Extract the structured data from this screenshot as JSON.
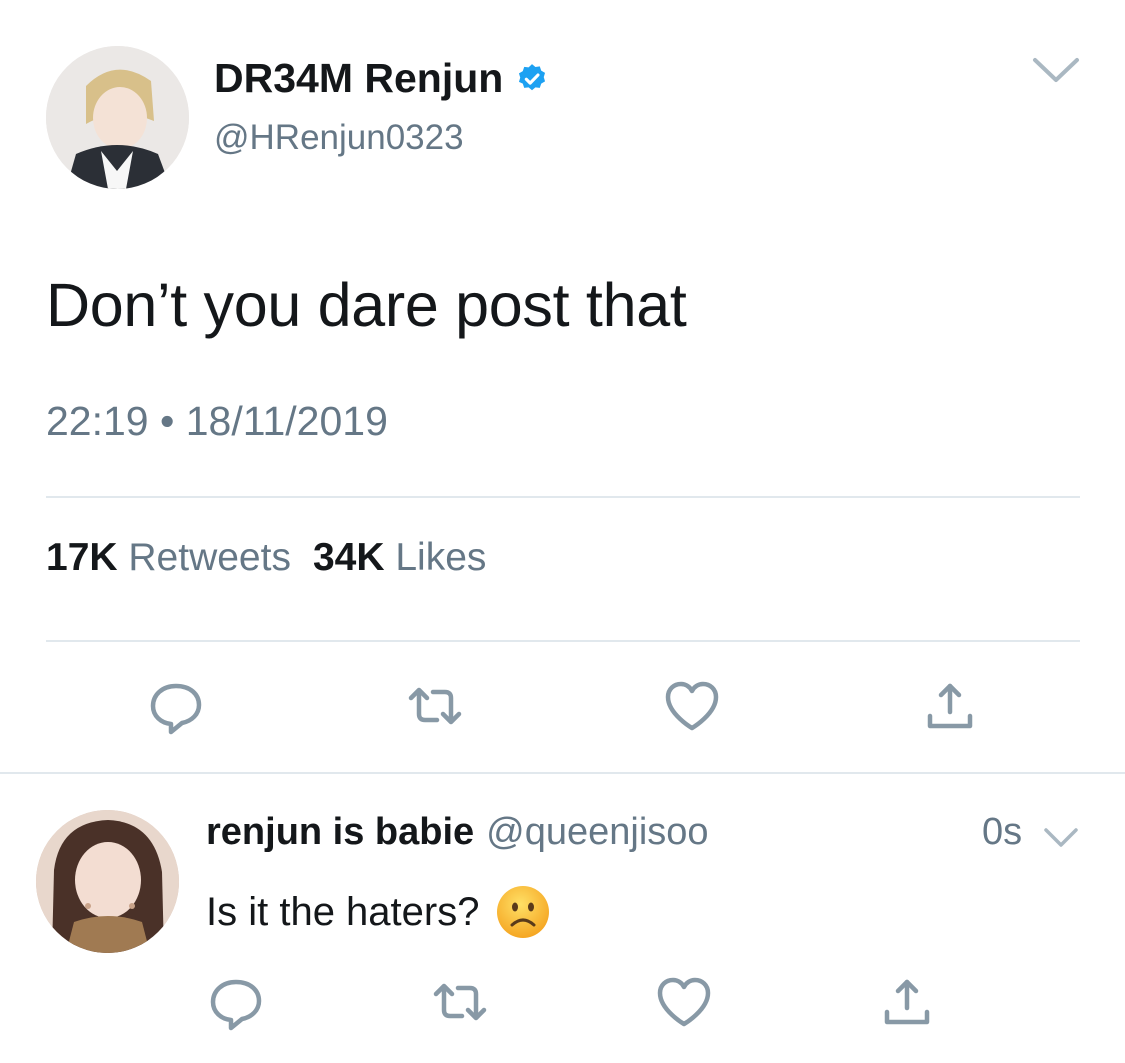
{
  "tweet": {
    "display_name": "DR34M Renjun",
    "handle": "@HRenjun0323",
    "text": "Don’t you dare post that",
    "timestamp": "22:19 • 18/11/2019",
    "retweets_count": "17K",
    "retweets_label": "Retweets",
    "likes_count": "34K",
    "likes_label": "Likes"
  },
  "reply": {
    "display_name": "renjun is babie",
    "handle": "@queenjisoo",
    "time": "0s",
    "text": "Is it the haters?"
  },
  "colors": {
    "verified": "#1da1f2",
    "secondary_text": "#657786",
    "icon_gray": "#8899a6",
    "divider": "#e1e8ed"
  },
  "icons": [
    "verified-badge-icon",
    "chevron-down-icon",
    "reply-icon",
    "retweet-icon",
    "like-icon",
    "share-icon",
    "frowning-face-emoji"
  ]
}
